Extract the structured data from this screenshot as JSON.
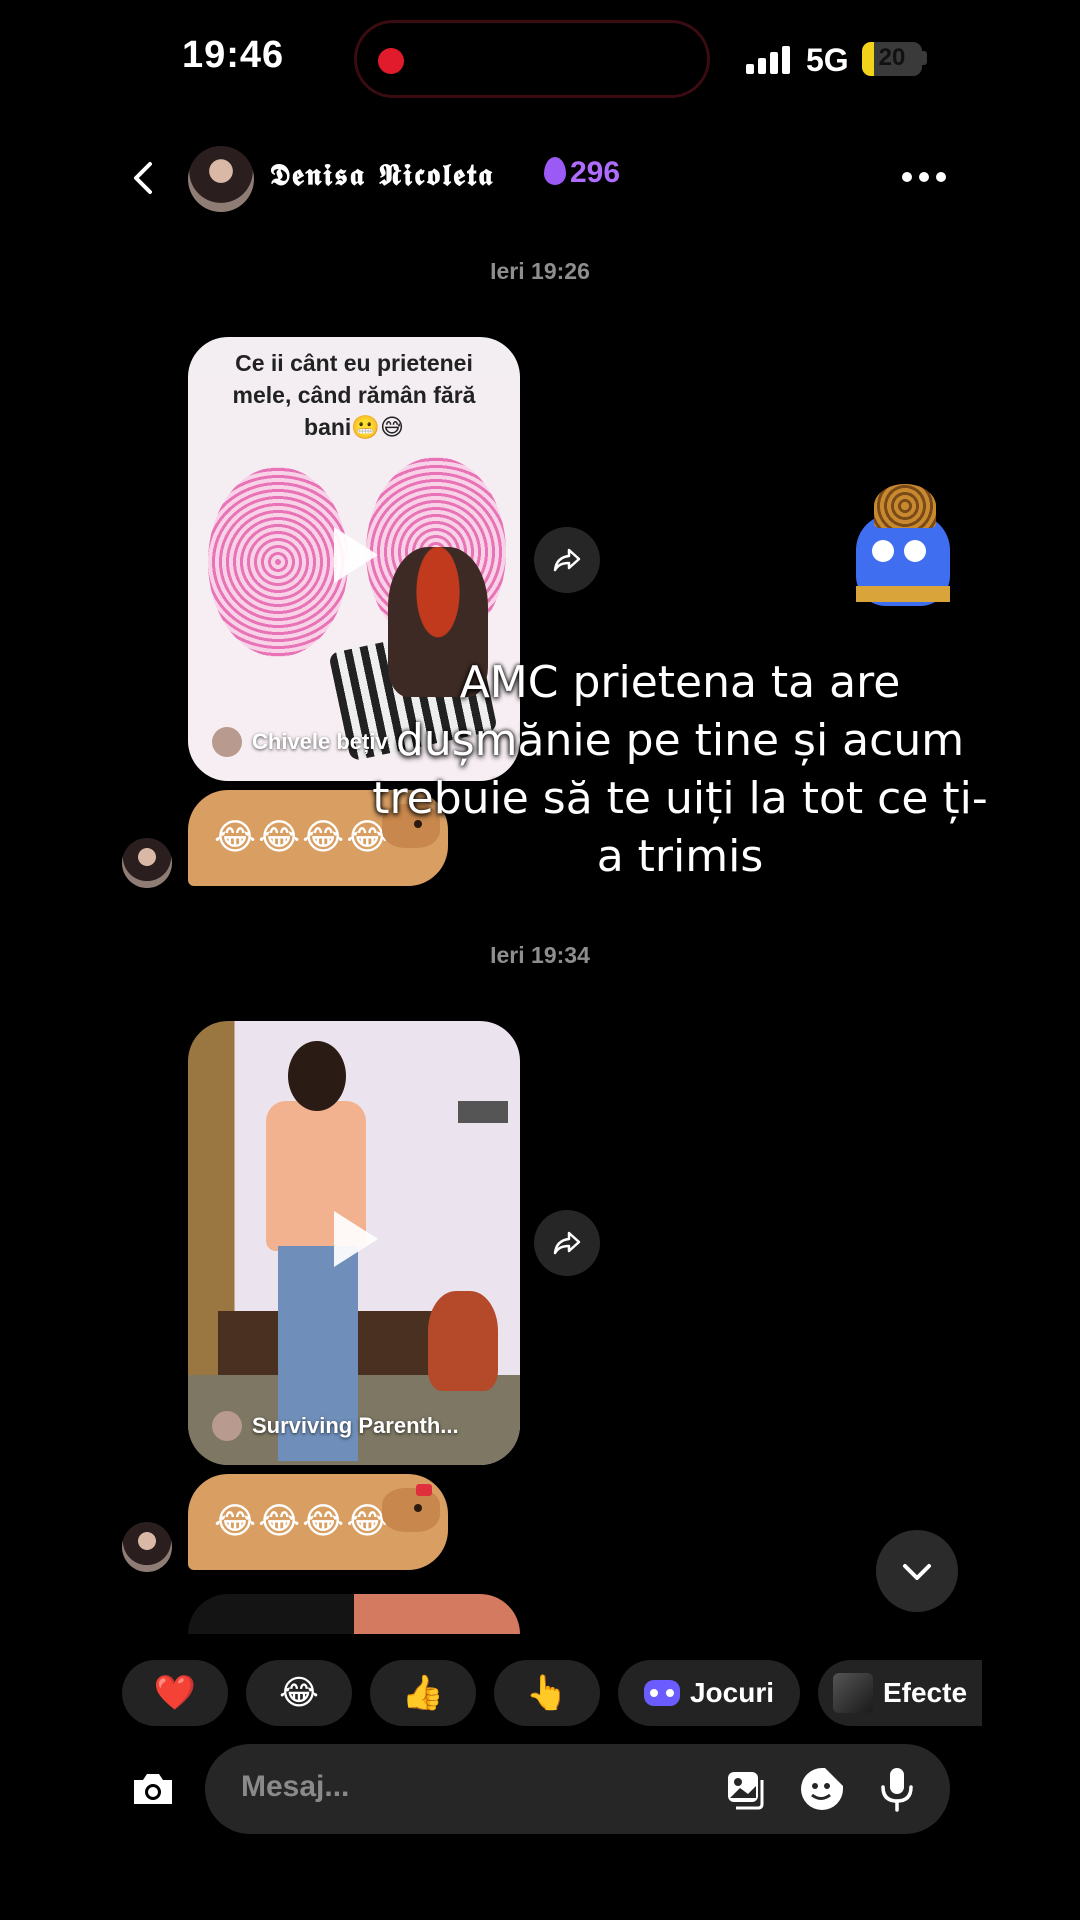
{
  "status_bar": {
    "time": "19:46",
    "network": "5G",
    "battery": "20",
    "battery_level": 0.2
  },
  "header": {
    "name": "𝕯𝖊𝖓𝖎𝖘𝖆 𝕹𝖎𝖈𝖔𝖑𝖊𝖙𝖆",
    "streak": "296"
  },
  "messages": [
    {
      "timestamp": "Ieri 19:26",
      "video": {
        "caption": "Ce ii cânt eu prietenei mele, când rămân fără bani😬😅",
        "source": "Chivele bețiv"
      },
      "sticker": "😂😂😂😂"
    },
    {
      "timestamp": "Ieri 19:34",
      "video": {
        "caption": "",
        "source": "Surviving Parenth..."
      },
      "sticker": "😂😂😂😂"
    }
  ],
  "overlay_text": "AMC prietena ta are dușmănie pe tine și acum trebuie să te uiți la tot ce ți-a trimis",
  "quick_reactions": [
    "❤️",
    "😂",
    "👍",
    "👆"
  ],
  "shortcuts": {
    "games": "Jocuri",
    "effects": "Efecte"
  },
  "composer": {
    "placeholder": "Mesaj..."
  },
  "icons": {
    "back": "chevron-left-icon",
    "more": "more-horizontal-icon",
    "share": "share-icon",
    "scroll_down": "chevron-down-icon",
    "camera": "camera-icon",
    "gallery": "gallery-icon",
    "sticker": "sticker-icon",
    "mic": "microphone-icon"
  },
  "colors": {
    "background": "#000000",
    "streak": "#b06cff",
    "battery": "#f2d21b",
    "sticker": "#d89e62"
  }
}
